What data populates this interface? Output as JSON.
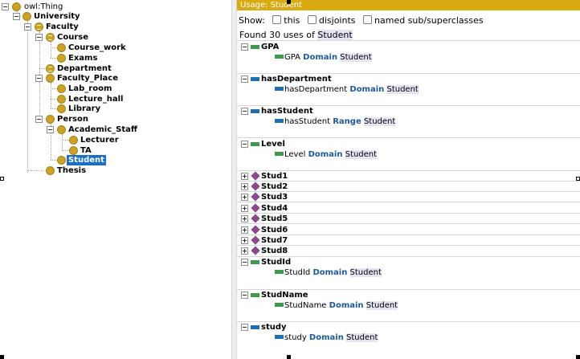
{
  "tree": {
    "root": "owl:Thing",
    "nodes": [
      {
        "label": "University"
      },
      {
        "label": "Faculty"
      },
      {
        "label": "Course"
      },
      {
        "label": "Course_work"
      },
      {
        "label": "Exams"
      },
      {
        "label": "Department"
      },
      {
        "label": "Faculty_Place"
      },
      {
        "label": "Lab_room"
      },
      {
        "label": "Lecture_hall"
      },
      {
        "label": "Library"
      },
      {
        "label": "Person"
      },
      {
        "label": "Academic_Staff"
      },
      {
        "label": "Lecturer"
      },
      {
        "label": "TA"
      },
      {
        "label": "Student"
      },
      {
        "label": "Thesis"
      }
    ],
    "selected": "Student"
  },
  "usage": {
    "title": "Usage: Student",
    "show_label": "Show:",
    "options": [
      "this",
      "disjoints",
      "named sub/superclasses"
    ],
    "found_prefix": "Found 30 uses of",
    "found_entity": "Student",
    "groups": [
      {
        "name": "GPA",
        "kind": "data",
        "axiom": {
          "subject": "GPA",
          "keyword": "Domain",
          "object": "Student"
        }
      },
      {
        "name": "hasDepartment",
        "kind": "obj",
        "axiom": {
          "subject": "hasDepartment",
          "keyword": "Domain",
          "object": "Student"
        }
      },
      {
        "name": "hasStudent",
        "kind": "obj",
        "axiom": {
          "subject": "hasStudent",
          "keyword": "Range",
          "object": "Student"
        }
      },
      {
        "name": "Level",
        "kind": "data",
        "axiom": {
          "subject": "Level",
          "keyword": "Domain",
          "object": "Student"
        }
      },
      {
        "name": "Stud1",
        "kind": "individual"
      },
      {
        "name": "Stud2",
        "kind": "individual"
      },
      {
        "name": "Stud3",
        "kind": "individual"
      },
      {
        "name": "Stud4",
        "kind": "individual"
      },
      {
        "name": "Stud5",
        "kind": "individual"
      },
      {
        "name": "Stud6",
        "kind": "individual"
      },
      {
        "name": "Stud7",
        "kind": "individual"
      },
      {
        "name": "Stud8",
        "kind": "individual"
      },
      {
        "name": "StudId",
        "kind": "data",
        "axiom": {
          "subject": "StudId",
          "keyword": "Domain",
          "object": "Student"
        }
      },
      {
        "name": "StudName",
        "kind": "data",
        "axiom": {
          "subject": "StudName",
          "keyword": "Domain",
          "object": "Student"
        }
      },
      {
        "name": "study",
        "kind": "obj",
        "axiom": {
          "subject": "study",
          "keyword": "Domain",
          "object": "Student"
        }
      }
    ]
  },
  "colors": {
    "header": "#d8ab12",
    "class_icon": "#c9a227",
    "selection": "#1a6fc4",
    "data_property": "#3f9b4a",
    "object_property": "#1f6fb3",
    "individual": "#8a4a8a",
    "keyword": "#1c5a9c"
  }
}
